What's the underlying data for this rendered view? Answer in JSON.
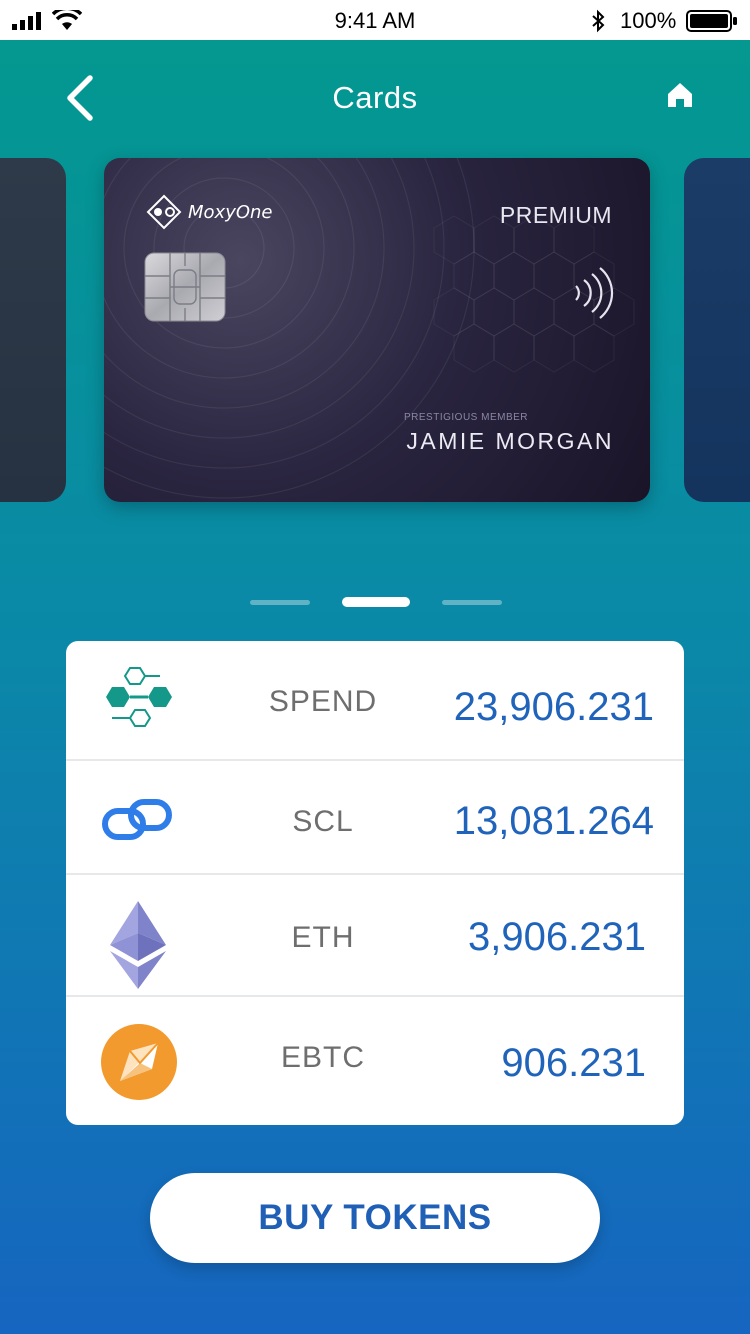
{
  "status_bar": {
    "time": "9:41 AM",
    "battery": "100%"
  },
  "header": {
    "title": "Cards"
  },
  "card": {
    "brand": "MoxyOne",
    "tier": "PREMIUM",
    "member_label": "PRESTIGIOUS MEMBER",
    "holder": "JAMIE MORGAN"
  },
  "pager": {
    "count": 3,
    "active": 2
  },
  "tokens": [
    {
      "name": "SPEND",
      "amount": "23,906.231",
      "icon": "spend-hexagon-icon"
    },
    {
      "name": "SCL",
      "amount": "13,081.264",
      "icon": "scl-chain-icon"
    },
    {
      "name": "ETH",
      "amount": "3,906.231",
      "icon": "ethereum-icon"
    },
    {
      "name": "EBTC",
      "amount": "906.231",
      "icon": "ebtc-icon"
    }
  ],
  "actions": {
    "buy_label": "BUY TOKENS"
  },
  "colors": {
    "accent_blue": "#1f63bb",
    "gradient_top": "#03998e",
    "gradient_bottom": "#1665c0",
    "spend_green": "#13988a",
    "scl_blue": "#2f7de8",
    "eth_purple": "#8c8fd4",
    "ebtc_orange": "#f29a2e"
  }
}
